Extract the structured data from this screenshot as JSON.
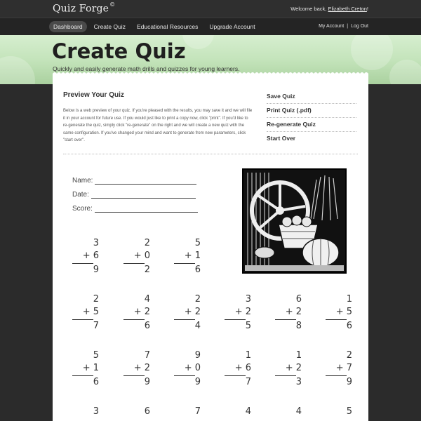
{
  "header": {
    "logo": "Quiz Forge",
    "logo_mark": "©",
    "welcome_prefix": "Welcome back,",
    "user_name": "Elizabeth Creton",
    "welcome_suffix": "!"
  },
  "nav": {
    "items": [
      "Dashboard",
      "Create Quiz",
      "Educational Resources",
      "Upgrade Account"
    ],
    "active_index": 0,
    "my_account": "My Account",
    "separator": "|",
    "logout": "Log Out"
  },
  "hero": {
    "title": "Create Quiz",
    "subtitle": "Quickly and easily generate math drills and quizzes for young learners."
  },
  "preview": {
    "title": "Preview Your Quiz",
    "description": "Below is a web preview of your quiz. If you're pleased with the results, you may save it and we will file it in your account for future use. If you would just like to print a copy now, click \"print\". If you'd like to re-generate the quiz, simply click \"re-generate\" on the right and we will create a new quiz with the same configuration. If you've changed your mind and want to generate from new parameters, click \"start over\"."
  },
  "actions": [
    "Save Quiz",
    "Print Quiz (.pdf)",
    "Re-generate Quiz",
    "Start Over"
  ],
  "quiz": {
    "fields": [
      "Name:",
      "Date:",
      "Score:"
    ],
    "image_icon": "harvest-illustration",
    "problems": [
      [
        {
          "a": "3",
          "op": "+ 6",
          "r": "9"
        },
        {
          "a": "2",
          "op": "+ 0",
          "r": "2"
        },
        {
          "a": "5",
          "op": "+ 1",
          "r": "6"
        }
      ],
      [
        {
          "a": "2",
          "op": "+ 5",
          "r": "7"
        },
        {
          "a": "4",
          "op": "+ 2",
          "r": "6"
        },
        {
          "a": "2",
          "op": "+ 2",
          "r": "4"
        },
        {
          "a": "3",
          "op": "+ 2",
          "r": "5"
        },
        {
          "a": "6",
          "op": "+ 2",
          "r": "8"
        },
        {
          "a": "1",
          "op": "+ 5",
          "r": "6"
        }
      ],
      [
        {
          "a": "5",
          "op": "+ 1",
          "r": "6"
        },
        {
          "a": "7",
          "op": "+ 2",
          "r": "9"
        },
        {
          "a": "9",
          "op": "+ 0",
          "r": "9"
        },
        {
          "a": "1",
          "op": "+ 6",
          "r": "7"
        },
        {
          "a": "1",
          "op": "+ 2",
          "r": "3"
        },
        {
          "a": "2",
          "op": "+ 7",
          "r": "9"
        }
      ],
      [
        {
          "a": "3"
        },
        {
          "a": "6"
        },
        {
          "a": "7"
        },
        {
          "a": "4"
        },
        {
          "a": "4"
        },
        {
          "a": "5"
        }
      ]
    ]
  },
  "colors": {
    "page_bg": "#2b2b2b",
    "hero_green": "#c4e4bb",
    "paper": "#ffffff"
  }
}
